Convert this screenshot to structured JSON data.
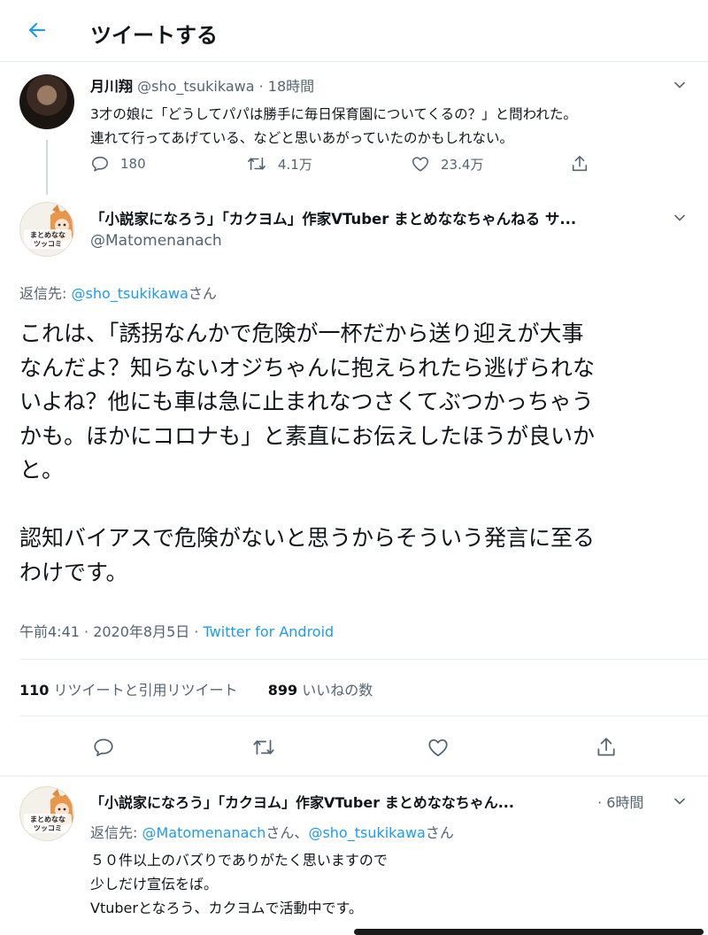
{
  "header": {
    "title": "ツイートする"
  },
  "parent_tweet": {
    "name": "月川翔",
    "handle": "@sho_tsukikawa",
    "separator": "·",
    "time": "18時間",
    "text_line1": "3才の娘に「どうしてパパは勝手に毎日保育園についてくるの？」と問われた。",
    "text_line2": "連れて行ってあげている、などと思いあがっていたのかもしれない。",
    "replies": "180",
    "retweets": "4.1万",
    "likes": "23.4万"
  },
  "main_tweet": {
    "name": "「小説家になろう」「カクヨム」作家VTuber まとめななちゃんねる サ...",
    "handle": "@Matomenanach",
    "reply_prefix": "返信先: ",
    "reply_handle": "@sho_tsukikawa",
    "reply_suffix": "さん",
    "text": "これは、「誘拐なんかで危険が一杯だから送り迎えが大事\nなんだよ？知らないオジちゃんに抱えられたら逃げられな\nいよね？他にも車は急に止まれなつさくてぶつかっちゃう\nかも。ほかにコロナも」と素直にお伝えしたほうが良いか\nと。\n\n認知バイアスで危険がないと思うからそういう発言に至る\nわけです。",
    "time": "午前4:41 · 2020年8月5日 · ",
    "source": "Twitter for Android",
    "retweet_count": "110",
    "retweet_label": "リツイートと引用リツイート",
    "like_count": "899",
    "like_label": "いいねの数"
  },
  "reply_tweet": {
    "name": "「小説家になろう」「カクヨム」作家VTuber まとめななちゃん...",
    "separator": "·",
    "time": "6時間",
    "reply_prefix": "返信先: ",
    "reply_handle1": "@Matomenanach",
    "reply_mid": "さん、",
    "reply_handle2": "@sho_tsukikawa",
    "reply_suffix": "さん",
    "text": "５０件以上のバズりでありがたく思いますので\n少しだけ宣伝をば。\nVtuberとなろう、カクヨムで活動中です。"
  },
  "avatar_label": {
    "line1": "まとめなな",
    "line2": "ツッコミ"
  },
  "colors": {
    "accent": "#1d9bf0",
    "muted": "#536471",
    "divider": "#e6ecf0"
  },
  "icons": [
    "back-arrow-icon",
    "chevron-down-icon",
    "reply-icon",
    "retweet-icon",
    "like-icon",
    "share-icon"
  ]
}
